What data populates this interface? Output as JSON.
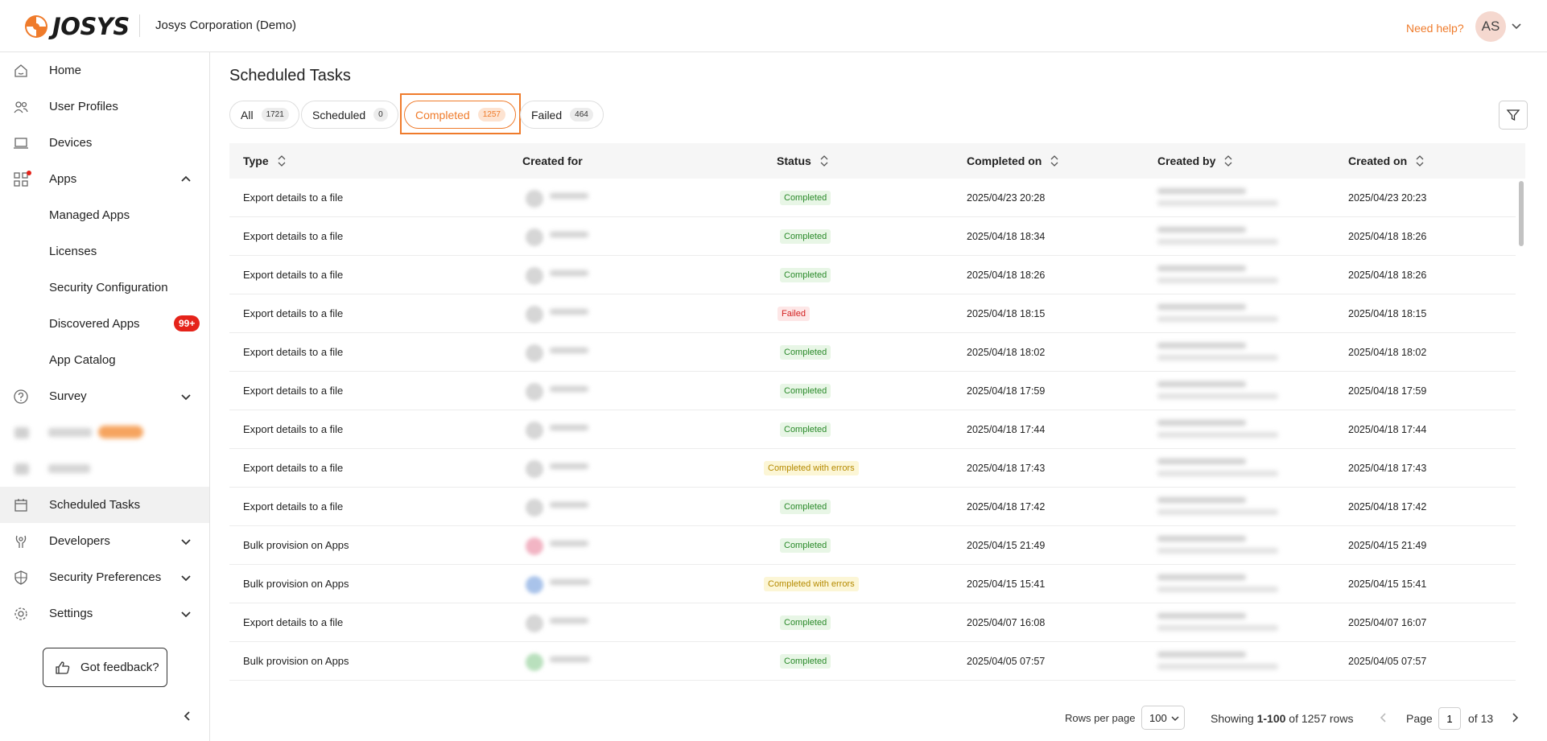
{
  "header": {
    "logo_text": "JOSYS",
    "org_name": "Josys Corporation (Demo)",
    "help_link": "Need help?",
    "avatar_initials": "AS"
  },
  "sidebar": {
    "items": [
      {
        "label": "Home",
        "icon": "home-icon"
      },
      {
        "label": "User Profiles",
        "icon": "users-icon"
      },
      {
        "label": "Devices",
        "icon": "laptop-icon"
      },
      {
        "label": "Apps",
        "icon": "apps-grid-icon",
        "expanded": true
      },
      {
        "label": "Managed Apps"
      },
      {
        "label": "Licenses"
      },
      {
        "label": "Security Configuration"
      },
      {
        "label": "Discovered Apps",
        "badge": "99+"
      },
      {
        "label": "App Catalog"
      },
      {
        "label": "Survey",
        "icon": "question-circle-icon"
      },
      {
        "label": "Scheduled Tasks",
        "icon": "calendar-icon",
        "active": true
      },
      {
        "label": "Developers",
        "icon": "developer-icon"
      },
      {
        "label": "Security Preferences",
        "icon": "shield-icon"
      },
      {
        "label": "Settings",
        "icon": "gear-icon"
      }
    ],
    "feedback_label": "Got feedback?"
  },
  "main": {
    "title": "Scheduled Tasks",
    "tabs": [
      {
        "label": "All",
        "count": "1721"
      },
      {
        "label": "Scheduled",
        "count": "0"
      },
      {
        "label": "Completed",
        "count": "1257",
        "active": true
      },
      {
        "label": "Failed",
        "count": "464"
      }
    ]
  },
  "table": {
    "columns": [
      "Type",
      "Created for",
      "Status",
      "Completed on",
      "Created by",
      "Created on"
    ],
    "rows": [
      {
        "type": "Export details to a file",
        "status": "Completed",
        "status_kind": "ok",
        "completed_on": "2025/04/23 20:28",
        "created_on": "2025/04/23 20:23"
      },
      {
        "type": "Export details to a file",
        "status": "Completed",
        "status_kind": "ok",
        "completed_on": "2025/04/18 18:34",
        "created_on": "2025/04/18 18:26"
      },
      {
        "type": "Export details to a file",
        "status": "Completed",
        "status_kind": "ok",
        "completed_on": "2025/04/18 18:26",
        "created_on": "2025/04/18 18:26"
      },
      {
        "type": "Export details to a file",
        "status": "Failed",
        "status_kind": "fail",
        "completed_on": "2025/04/18 18:15",
        "created_on": "2025/04/18 18:15"
      },
      {
        "type": "Export details to a file",
        "status": "Completed",
        "status_kind": "ok",
        "completed_on": "2025/04/18 18:02",
        "created_on": "2025/04/18 18:02"
      },
      {
        "type": "Export details to a file",
        "status": "Completed",
        "status_kind": "ok",
        "completed_on": "2025/04/18 17:59",
        "created_on": "2025/04/18 17:59"
      },
      {
        "type": "Export details to a file",
        "status": "Completed",
        "status_kind": "ok",
        "completed_on": "2025/04/18 17:44",
        "created_on": "2025/04/18 17:44"
      },
      {
        "type": "Export details to a file",
        "status": "Completed with errors",
        "status_kind": "warn",
        "completed_on": "2025/04/18 17:43",
        "created_on": "2025/04/18 17:43"
      },
      {
        "type": "Export details to a file",
        "status": "Completed",
        "status_kind": "ok",
        "completed_on": "2025/04/18 17:42",
        "created_on": "2025/04/18 17:42"
      },
      {
        "type": "Bulk provision on Apps",
        "status": "Completed",
        "status_kind": "ok",
        "completed_on": "2025/04/15 21:49",
        "created_on": "2025/04/15 21:49"
      },
      {
        "type": "Bulk provision on Apps",
        "status": "Completed with errors",
        "status_kind": "warn",
        "completed_on": "2025/04/15 15:41",
        "created_on": "2025/04/15 15:41"
      },
      {
        "type": "Export details to a file",
        "status": "Completed",
        "status_kind": "ok",
        "completed_on": "2025/04/07 16:08",
        "created_on": "2025/04/07 16:07"
      },
      {
        "type": "Bulk provision on Apps",
        "status": "Completed",
        "status_kind": "ok",
        "completed_on": "2025/04/05 07:57",
        "created_on": "2025/04/05 07:57"
      }
    ]
  },
  "footer": {
    "rows_per_page_label": "Rows per page",
    "rows_per_page_value": "100",
    "showing_prefix": "Showing",
    "showing_range": "1-100",
    "showing_suffix": "of 1257 rows",
    "page_label": "Page",
    "page_value": "1",
    "page_total": "of 13"
  },
  "colors": {
    "accent": "#ef7b2b",
    "badge_red": "#e5231a",
    "completed": "#2a8a2a",
    "failed": "#d32121",
    "with_errors": "#b58a00"
  }
}
